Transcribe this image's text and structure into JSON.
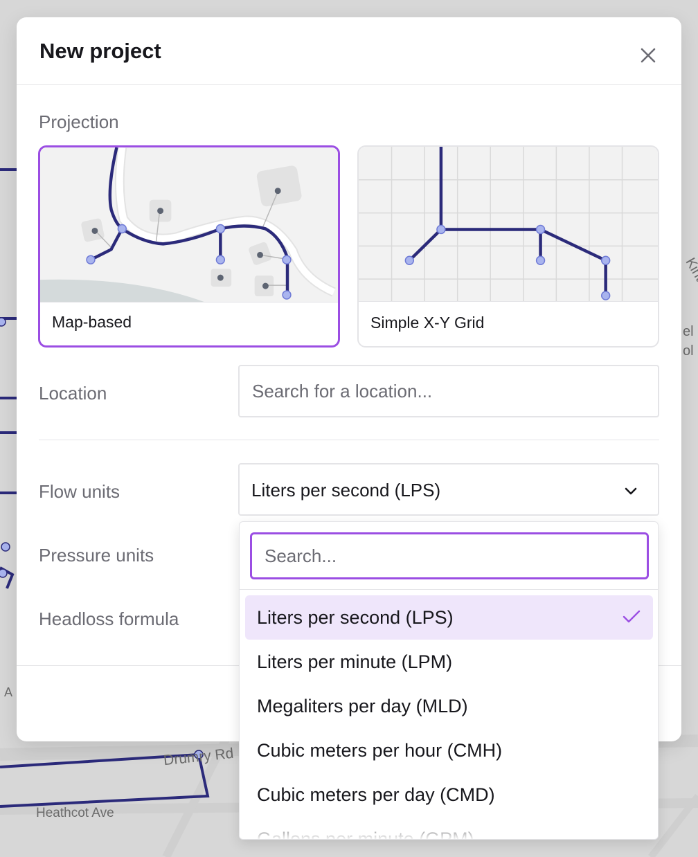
{
  "map": {
    "streets": [
      "Drumry Rd",
      "Heathcot Ave"
    ],
    "edge_fragments": [
      "Kint",
      "el",
      "ol",
      "A"
    ]
  },
  "modal": {
    "title": "New project",
    "close_icon": "close-icon"
  },
  "projection": {
    "label": "Projection",
    "options": [
      {
        "label": "Map-based",
        "selected": true
      },
      {
        "label": "Simple X-Y Grid",
        "selected": false
      }
    ]
  },
  "location": {
    "label": "Location",
    "placeholder": "Search for a location..."
  },
  "flow_units": {
    "label": "Flow units",
    "value": "Liters per second (LPS)"
  },
  "pressure_units": {
    "label": "Pressure units"
  },
  "headloss_formula": {
    "label": "Headloss formula"
  },
  "dropdown": {
    "search_placeholder": "Search...",
    "options": [
      "Liters per second (LPS)",
      "Liters per minute (LPM)",
      "Megaliters per day (MLD)",
      "Cubic meters per hour (CMH)",
      "Cubic meters per day (CMD)",
      "Gallons per minute (GPM)"
    ],
    "selected_index": 0
  },
  "colors": {
    "accent": "#9b4ee3",
    "selected_bg": "#efe6fb",
    "pipe": "#2b2a7a",
    "node": "#a9b4ee"
  }
}
